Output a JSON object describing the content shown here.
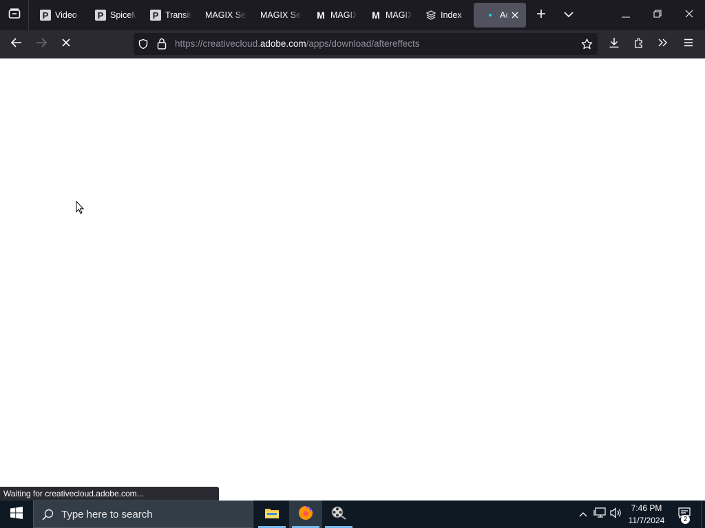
{
  "browser": {
    "tabs": [
      {
        "title": "Video",
        "favicon": "P",
        "favicon_type": "p-icon",
        "active": false
      },
      {
        "title": "SpiceM",
        "favicon": "P",
        "favicon_type": "p-icon",
        "active": false
      },
      {
        "title": "Transit",
        "favicon": "P",
        "favicon_type": "p-icon",
        "active": false
      },
      {
        "title": "MAGIX Ser",
        "favicon": "",
        "favicon_type": "none",
        "active": false
      },
      {
        "title": "MAGIX Ser",
        "favicon": "",
        "favicon_type": "none",
        "active": false
      },
      {
        "title": "MAGIX",
        "favicon": "M",
        "favicon_type": "m-icon",
        "active": false
      },
      {
        "title": "MAGIX",
        "favicon": "M",
        "favicon_type": "m-icon",
        "active": false
      },
      {
        "title": "Index",
        "favicon": "",
        "favicon_type": "stack-icon",
        "active": false
      },
      {
        "title": "Ado",
        "favicon": "",
        "favicon_type": "loading-dot",
        "active": true
      }
    ],
    "url": {
      "scheme": "https://",
      "subdomain": "creativecloud.",
      "host": "adobe.com",
      "path": "/apps/download/aftereffects"
    },
    "status_text": "Waiting for creativecloud.adobe.com..."
  },
  "taskbar": {
    "search_placeholder": "Type here to search",
    "clock_time": "7:46 PM",
    "clock_date": "11/7/2024",
    "notification_count": "2"
  },
  "colors": {
    "tabbar_bg": "#1c1b22",
    "navbar_bg": "#2b2a33",
    "urlbar_bg": "#1c1b22",
    "taskbar_bg": "#0f1923",
    "active_tab": "#52525e"
  }
}
